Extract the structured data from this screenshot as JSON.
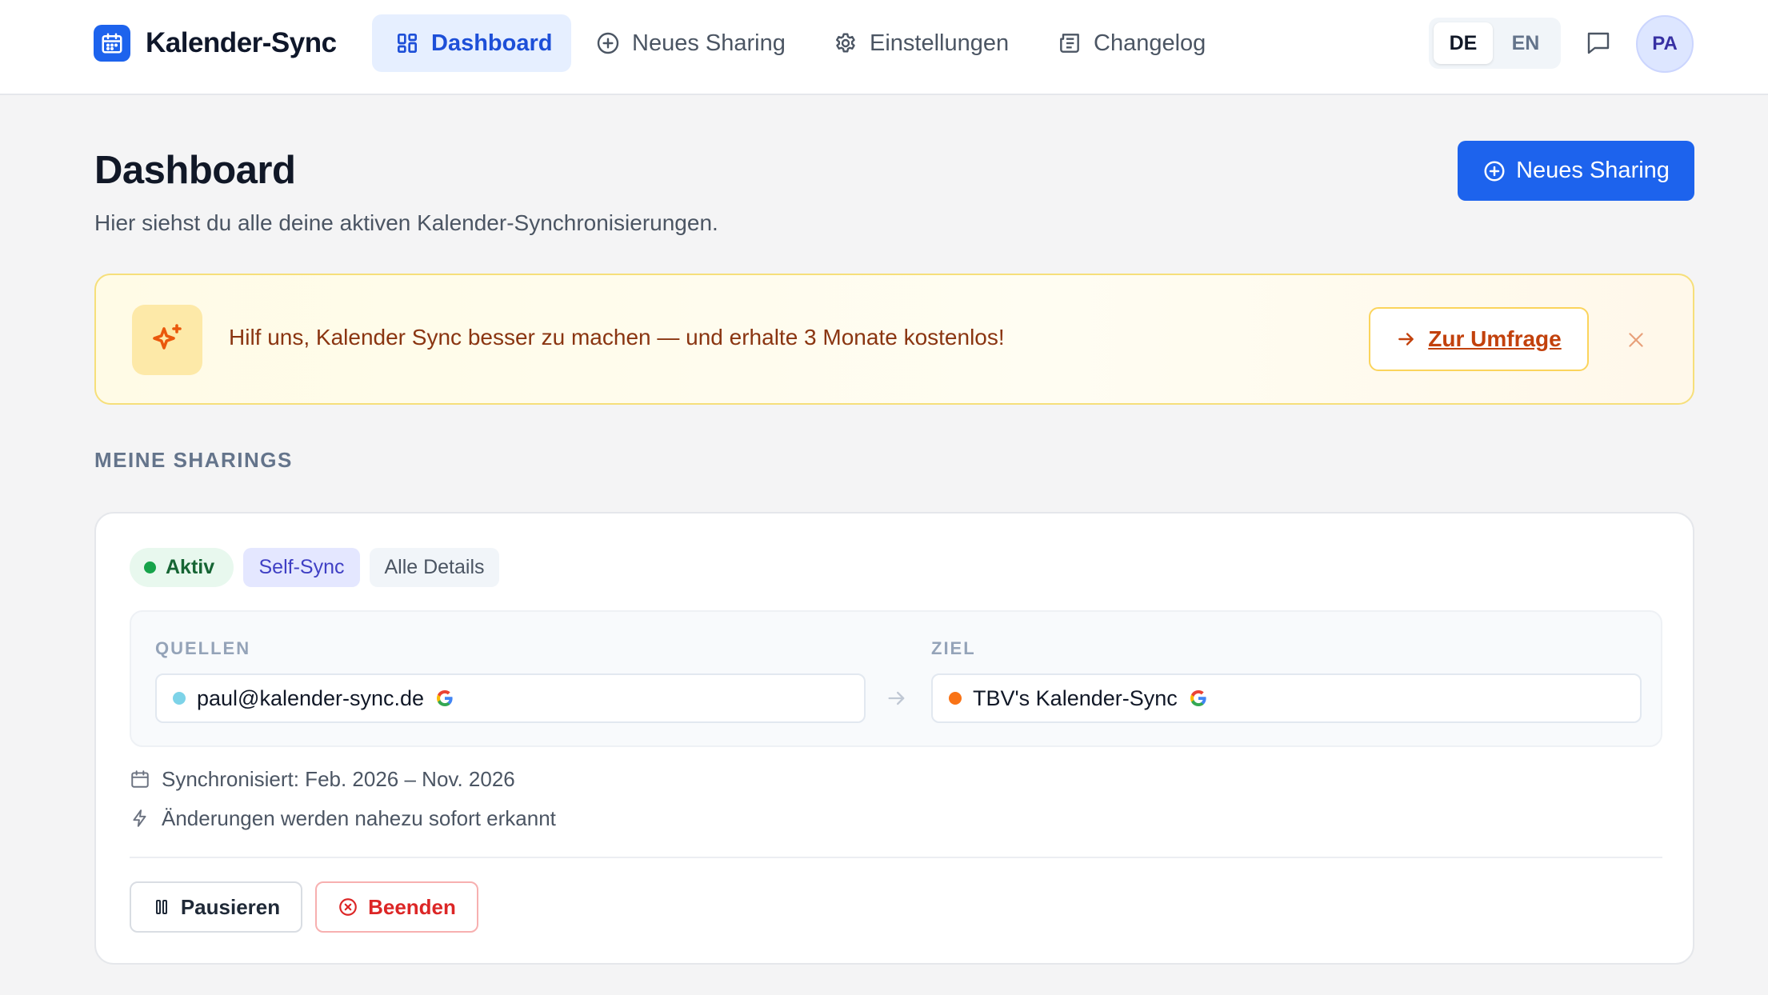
{
  "header": {
    "app_title": "Kalender-Sync",
    "nav": [
      {
        "label": "Dashboard",
        "icon": "dashboard-grid-icon",
        "active": true
      },
      {
        "label": "Neues Sharing",
        "icon": "plus-circle-icon",
        "active": false
      },
      {
        "label": "Einstellungen",
        "icon": "gear-icon",
        "active": false
      },
      {
        "label": "Changelog",
        "icon": "newspaper-icon",
        "active": false
      }
    ],
    "languages": [
      {
        "code": "DE",
        "active": true
      },
      {
        "code": "EN",
        "active": false
      }
    ],
    "avatar_initials": "PA"
  },
  "page": {
    "title": "Dashboard",
    "subtitle": "Hier siehst du alle deine aktiven Kalender-Synchronisierungen.",
    "new_sharing_button": "Neues Sharing"
  },
  "banner": {
    "text": "Hilf uns, Kalender Sync besser zu machen — und erhalte 3 Monate kostenlos!",
    "button_label": "Zur Umfrage"
  },
  "sharings": {
    "section_label": "MEINE SHARINGS",
    "items": [
      {
        "status": "Aktiv",
        "type": "Self-Sync",
        "details_label": "Alle Details",
        "sources_label": "QUELLEN",
        "target_label": "ZIEL",
        "source": {
          "name": "paul@kalender-sync.de",
          "color": "#7dd3e8",
          "provider_icon": "google-icon"
        },
        "target": {
          "name": "TBV's Kalender-Sync",
          "color": "#f97316",
          "provider_icon": "google-icon"
        },
        "sync_range": "Synchronisiert: Feb. 2026 – Nov. 2026",
        "change_detection": "Änderungen werden nahezu sofort erkannt",
        "pause_label": "Pausieren",
        "end_label": "Beenden"
      }
    ]
  },
  "colors": {
    "primary": "#1d63ed",
    "active_green": "#16a34a",
    "danger": "#dc2626",
    "banner_text": "#8a3511"
  }
}
